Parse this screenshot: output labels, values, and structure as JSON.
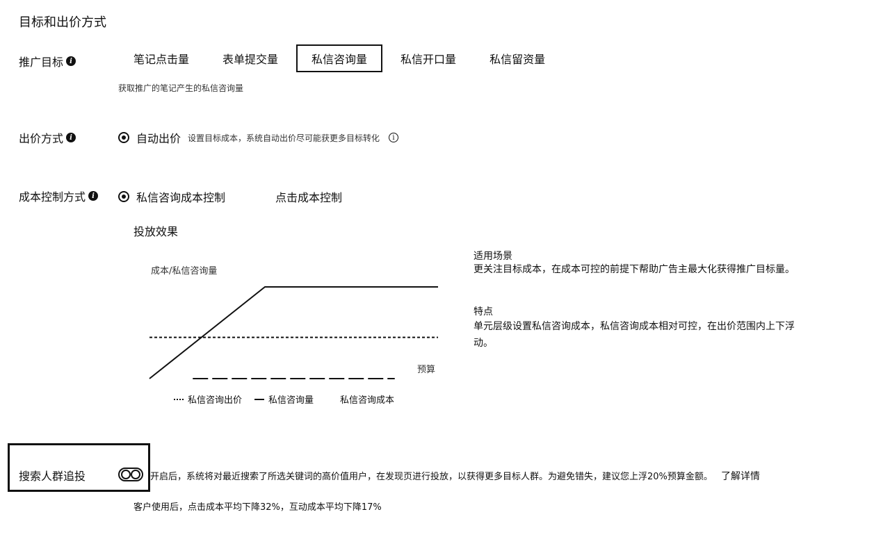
{
  "section": {
    "title": "目标和出价方式"
  },
  "goal_row": {
    "label": "推广目标",
    "info_icon": "info-filled-icon",
    "options": [
      "笔记点击量",
      "表单提交量",
      "私信咨询量",
      "私信开口量",
      "私信留资量"
    ],
    "selected": "私信咨询量",
    "hint": "获取推广的笔记产生的私信咨询量"
  },
  "bid_row": {
    "label": "出价方式",
    "option": "自动出价",
    "selected": true,
    "hint": "设置目标成本，系统自动出价尽可能获更多目标转化",
    "hint_icon": "info-circle-icon"
  },
  "cost_row": {
    "label": "成本控制方式",
    "options": [
      {
        "label": "私信咨询成本控制",
        "selected": true
      },
      {
        "label": "点击成本控制",
        "selected": false
      }
    ]
  },
  "effect": {
    "title": "投放效果",
    "scene_heading": "适用场景",
    "scene_text": "更关注目标成本，在成本可控的前提下帮助广告主最大化获得推广目标量。",
    "feature_heading": "特点",
    "feature_text": "单元层级设置私信咨询成本，私信咨询成本相对可控，在出价范围内上下浮动。"
  },
  "chart_data": {
    "type": "line",
    "ylabel": "成本/私信咨询量",
    "xlabel": "预算",
    "series": [
      {
        "name": "私信咨询出价",
        "style": "dotted",
        "x": [
          0,
          1
        ],
        "y": [
          0.45,
          0.45
        ]
      },
      {
        "name": "私信咨询量",
        "style": "solid",
        "x": [
          0,
          0.4,
          1
        ],
        "y": [
          0,
          1,
          1
        ]
      },
      {
        "name": "私信咨询成本",
        "style": "dashed",
        "x": [
          0.15,
          0.5,
          0.85
        ],
        "y": [
          0,
          0,
          0
        ]
      }
    ]
  },
  "search": {
    "label": "搜索人群追投",
    "toggle_on": false,
    "desc": "开启后，系统将对最近搜索了所选关键词的高价值用户，在发现页进行投放，以获得更多目标人群。为避免错失，建议您上浮20%预算金额。",
    "link": "了解详情",
    "stat": "客户使用后，点击成本平均下降32%，互动成本平均下降17%"
  },
  "colors": {
    "text": "#111111",
    "background": "#ffffff"
  }
}
